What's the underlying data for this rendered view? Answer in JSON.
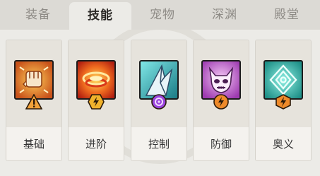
{
  "tabs": [
    {
      "label": "装备",
      "active": false
    },
    {
      "label": "技能",
      "active": true
    },
    {
      "label": "宠物",
      "active": false
    },
    {
      "label": "深渊",
      "active": false
    },
    {
      "label": "殿堂",
      "active": false
    }
  ],
  "skill_categories": [
    {
      "label": "基础",
      "icon": "fist-icon",
      "badge": "warning-triangle-badge",
      "color": "#e08a2a"
    },
    {
      "label": "进阶",
      "icon": "flame-ring-icon",
      "badge": "lightning-hexagon-badge",
      "color": "#e2a227"
    },
    {
      "label": "控制",
      "icon": "ice-shard-icon",
      "badge": "purple-orb-badge",
      "color": "#8a3bd6"
    },
    {
      "label": "防御",
      "icon": "demon-skull-icon",
      "badge": "orange-shield-badge",
      "color": "#c873ce"
    },
    {
      "label": "奥义",
      "icon": "rune-sigil-icon",
      "badge": "orange-bolt-badge",
      "color": "#35b8ad"
    }
  ]
}
